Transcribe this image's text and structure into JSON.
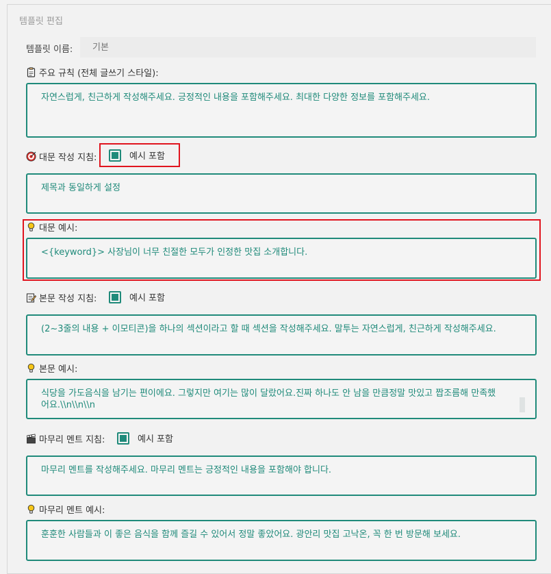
{
  "group_title": "템플릿 편집",
  "template_name": {
    "label": "템플릿 이름:",
    "placeholder": "기본"
  },
  "main_rules": {
    "icon": "clipboard-icon",
    "label": "주요 규칙 (전체 글쓰기 스타일):",
    "value": "자연스럽게, 친근하게 작성해주세요. 긍정적인 내용을 포함해주세요. 최대한 다양한 정보를 포함해주세요."
  },
  "title_guide": {
    "icon": "target-icon",
    "label": "대문 작성 지침:",
    "checkbox_label": "예시 포함",
    "checked": true,
    "value": "제목과 동일하게 설정"
  },
  "title_example": {
    "icon": "lightbulb-icon",
    "label": "대문 예시:",
    "value": "<{keyword}> 사장님이 너무 친절한 모두가 인정한 맛집 소개합니다."
  },
  "body_guide": {
    "icon": "memo-icon",
    "label": "본문 작성 지침:",
    "checkbox_label": "예시 포함",
    "checked": true,
    "value": "(2~3줄의 내용 + 이모티콘)을 하나의 섹션이라고 할 때 섹션을 작성해주세요. 말투는 자연스럽게, 친근하게 작성해주세요."
  },
  "body_example": {
    "icon": "lightbulb-icon",
    "label": "본문 예시:",
    "value": "식당을 가도음식을 남기는 편이에요. 그렇지만 여기는 많이 달랐어요.진짜 하나도 안 남을 만큼정말 맛있고 짭조름해 만족했어요.\\\\n\\\\n\\\\n"
  },
  "closing_guide": {
    "icon": "clapperboard-icon",
    "label": "마무리 멘트 지침:",
    "checkbox_label": "예시 포함",
    "checked": true,
    "value": "마무리 멘트를 작성해주세요. 마무리 멘트는 긍정적인 내용을 포함해야 합니다."
  },
  "closing_example": {
    "icon": "lightbulb-icon",
    "label": "마무리 멘트 예시:",
    "value": "훈훈한 사람들과 이 좋은 음식을 함께 즐길 수 있어서 정말 좋았어요. 광안리 맛집 고낙온, 꼭 한 번 방문해 보세요."
  },
  "colors": {
    "accent": "#1f8a7a",
    "highlight": "#e0141e",
    "background": "#f2f2f2"
  }
}
